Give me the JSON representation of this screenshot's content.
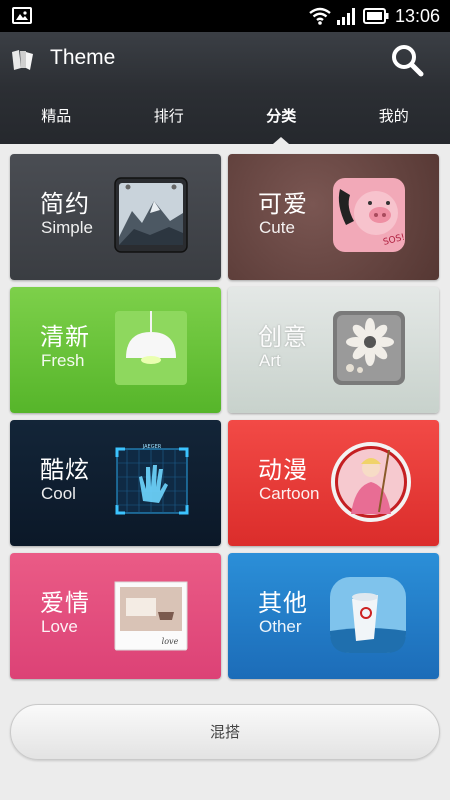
{
  "status": {
    "time": "13:06"
  },
  "appbar": {
    "title": "Theme"
  },
  "tabs": [
    {
      "label": "精品"
    },
    {
      "label": "排行"
    },
    {
      "label": "分类"
    },
    {
      "label": "我的"
    }
  ],
  "categories": [
    {
      "cn": "简约",
      "en": "Simple"
    },
    {
      "cn": "可爱",
      "en": "Cute"
    },
    {
      "cn": "清新",
      "en": "Fresh"
    },
    {
      "cn": "创意",
      "en": "Art"
    },
    {
      "cn": "酷炫",
      "en": "Cool"
    },
    {
      "cn": "动漫",
      "en": "Cartoon"
    },
    {
      "cn": "爱情",
      "en": "Love"
    },
    {
      "cn": "其他",
      "en": "Other"
    }
  ],
  "thumb_text": {
    "cute_badge": "SOS!",
    "cool_label": "JAEGER",
    "love_caption": "love"
  },
  "footer": {
    "mix_label": "混搭"
  }
}
